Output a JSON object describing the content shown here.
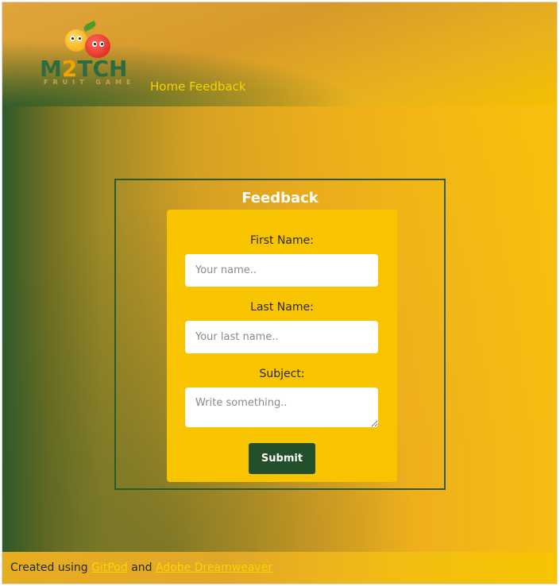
{
  "header": {
    "logo": {
      "title_left": "M",
      "title_two": "2",
      "title_right": "TCH",
      "subtitle": "FRUIT GAME"
    },
    "nav": [
      {
        "label": "Home"
      },
      {
        "label": "Feedback"
      }
    ]
  },
  "form": {
    "title": "Feedback",
    "first_name": {
      "label": "First Name:",
      "placeholder": "Your name.."
    },
    "last_name": {
      "label": "Last Name:",
      "placeholder": "Your last name.."
    },
    "subject": {
      "label": "Subject:",
      "placeholder": "Write something.."
    },
    "submit_label": "Submit"
  },
  "footer": {
    "prefix": "Created using",
    "link1": "GitPod",
    "conjunction": "and",
    "link2": "Adobe Dreamweaver"
  },
  "colors": {
    "accent_yellow": "#f8c400",
    "dark_green": "#23502a",
    "nav_text": "#f7d200"
  }
}
